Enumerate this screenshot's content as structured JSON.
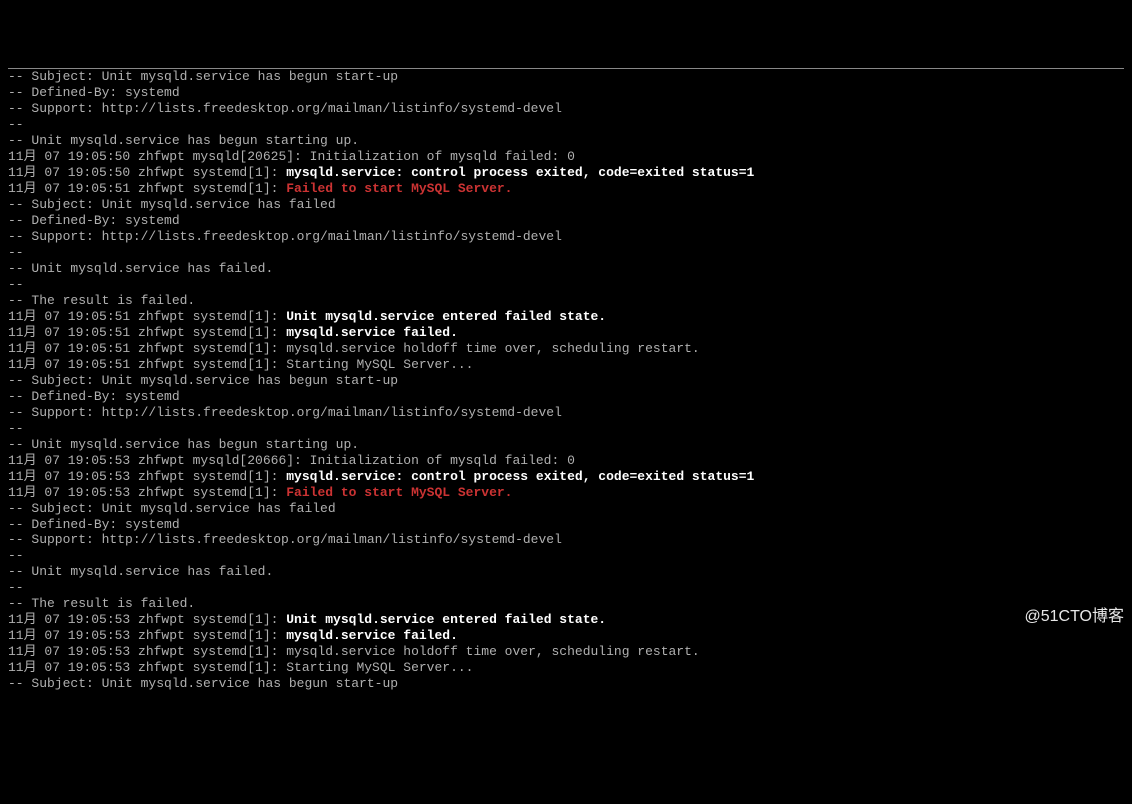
{
  "log_lines": [
    {
      "segments": [
        {
          "text": "-- Subject: Unit mysqld.service has begun start-up",
          "style": ""
        }
      ]
    },
    {
      "segments": [
        {
          "text": "-- Defined-By: systemd",
          "style": ""
        }
      ]
    },
    {
      "segments": [
        {
          "text": "-- Support: http://lists.freedesktop.org/mailman/listinfo/systemd-devel",
          "style": ""
        }
      ]
    },
    {
      "segments": [
        {
          "text": "--",
          "style": ""
        }
      ]
    },
    {
      "segments": [
        {
          "text": "-- Unit mysqld.service has begun starting up.",
          "style": ""
        }
      ]
    },
    {
      "segments": [
        {
          "text": "11月 07 19:05:50 zhfwpt mysqld[20625]: Initialization of mysqld failed: 0",
          "style": ""
        }
      ]
    },
    {
      "segments": [
        {
          "text": "11月 07 19:05:50 zhfwpt systemd[1]: ",
          "style": ""
        },
        {
          "text": "mysqld.service: control process exited, code=exited status=1",
          "style": "bold-white"
        }
      ]
    },
    {
      "segments": [
        {
          "text": "11月 07 19:05:51 zhfwpt systemd[1]: ",
          "style": ""
        },
        {
          "text": "Failed to start MySQL Server.",
          "style": "bold-red"
        }
      ]
    },
    {
      "segments": [
        {
          "text": "-- Subject: Unit mysqld.service has failed",
          "style": ""
        }
      ]
    },
    {
      "segments": [
        {
          "text": "-- Defined-By: systemd",
          "style": ""
        }
      ]
    },
    {
      "segments": [
        {
          "text": "-- Support: http://lists.freedesktop.org/mailman/listinfo/systemd-devel",
          "style": ""
        }
      ]
    },
    {
      "segments": [
        {
          "text": "--",
          "style": ""
        }
      ]
    },
    {
      "segments": [
        {
          "text": "-- Unit mysqld.service has failed.",
          "style": ""
        }
      ]
    },
    {
      "segments": [
        {
          "text": "--",
          "style": ""
        }
      ]
    },
    {
      "segments": [
        {
          "text": "-- The result is failed.",
          "style": ""
        }
      ]
    },
    {
      "segments": [
        {
          "text": "11月 07 19:05:51 zhfwpt systemd[1]: ",
          "style": ""
        },
        {
          "text": "Unit mysqld.service entered failed state.",
          "style": "bold-white"
        }
      ]
    },
    {
      "segments": [
        {
          "text": "11月 07 19:05:51 zhfwpt systemd[1]: ",
          "style": ""
        },
        {
          "text": "mysqld.service failed.",
          "style": "bold-white"
        }
      ]
    },
    {
      "segments": [
        {
          "text": "11月 07 19:05:51 zhfwpt systemd[1]: mysqld.service holdoff time over, scheduling restart.",
          "style": ""
        }
      ]
    },
    {
      "segments": [
        {
          "text": "11月 07 19:05:51 zhfwpt systemd[1]: Starting MySQL Server...",
          "style": ""
        }
      ]
    },
    {
      "segments": [
        {
          "text": "-- Subject: Unit mysqld.service has begun start-up",
          "style": ""
        }
      ]
    },
    {
      "segments": [
        {
          "text": "-- Defined-By: systemd",
          "style": ""
        }
      ]
    },
    {
      "segments": [
        {
          "text": "-- Support: http://lists.freedesktop.org/mailman/listinfo/systemd-devel",
          "style": ""
        }
      ]
    },
    {
      "segments": [
        {
          "text": "--",
          "style": ""
        }
      ]
    },
    {
      "segments": [
        {
          "text": "-- Unit mysqld.service has begun starting up.",
          "style": ""
        }
      ]
    },
    {
      "segments": [
        {
          "text": "11月 07 19:05:53 zhfwpt mysqld[20666]: Initialization of mysqld failed: 0",
          "style": ""
        }
      ]
    },
    {
      "segments": [
        {
          "text": "11月 07 19:05:53 zhfwpt systemd[1]: ",
          "style": ""
        },
        {
          "text": "mysqld.service: control process exited, code=exited status=1",
          "style": "bold-white"
        }
      ]
    },
    {
      "segments": [
        {
          "text": "11月 07 19:05:53 zhfwpt systemd[1]: ",
          "style": ""
        },
        {
          "text": "Failed to start MySQL Server.",
          "style": "bold-red"
        }
      ]
    },
    {
      "segments": [
        {
          "text": "-- Subject: Unit mysqld.service has failed",
          "style": ""
        }
      ]
    },
    {
      "segments": [
        {
          "text": "-- Defined-By: systemd",
          "style": ""
        }
      ]
    },
    {
      "segments": [
        {
          "text": "-- Support: http://lists.freedesktop.org/mailman/listinfo/systemd-devel",
          "style": ""
        }
      ]
    },
    {
      "segments": [
        {
          "text": "--",
          "style": ""
        }
      ]
    },
    {
      "segments": [
        {
          "text": "-- Unit mysqld.service has failed.",
          "style": ""
        }
      ]
    },
    {
      "segments": [
        {
          "text": "--",
          "style": ""
        }
      ]
    },
    {
      "segments": [
        {
          "text": "-- The result is failed.",
          "style": ""
        }
      ]
    },
    {
      "segments": [
        {
          "text": "11月 07 19:05:53 zhfwpt systemd[1]: ",
          "style": ""
        },
        {
          "text": "Unit mysqld.service entered failed state.",
          "style": "bold-white"
        }
      ]
    },
    {
      "segments": [
        {
          "text": "11月 07 19:05:53 zhfwpt systemd[1]: ",
          "style": ""
        },
        {
          "text": "mysqld.service failed.",
          "style": "bold-white"
        }
      ]
    },
    {
      "segments": [
        {
          "text": "11月 07 19:05:53 zhfwpt systemd[1]: mysqld.service holdoff time over, scheduling restart.",
          "style": ""
        }
      ]
    },
    {
      "segments": [
        {
          "text": "11月 07 19:05:53 zhfwpt systemd[1]: Starting MySQL Server...",
          "style": ""
        }
      ]
    },
    {
      "segments": [
        {
          "text": "-- Subject: Unit mysqld.service has begun start-up",
          "style": ""
        }
      ]
    }
  ],
  "watermark": "@51CTO博客"
}
